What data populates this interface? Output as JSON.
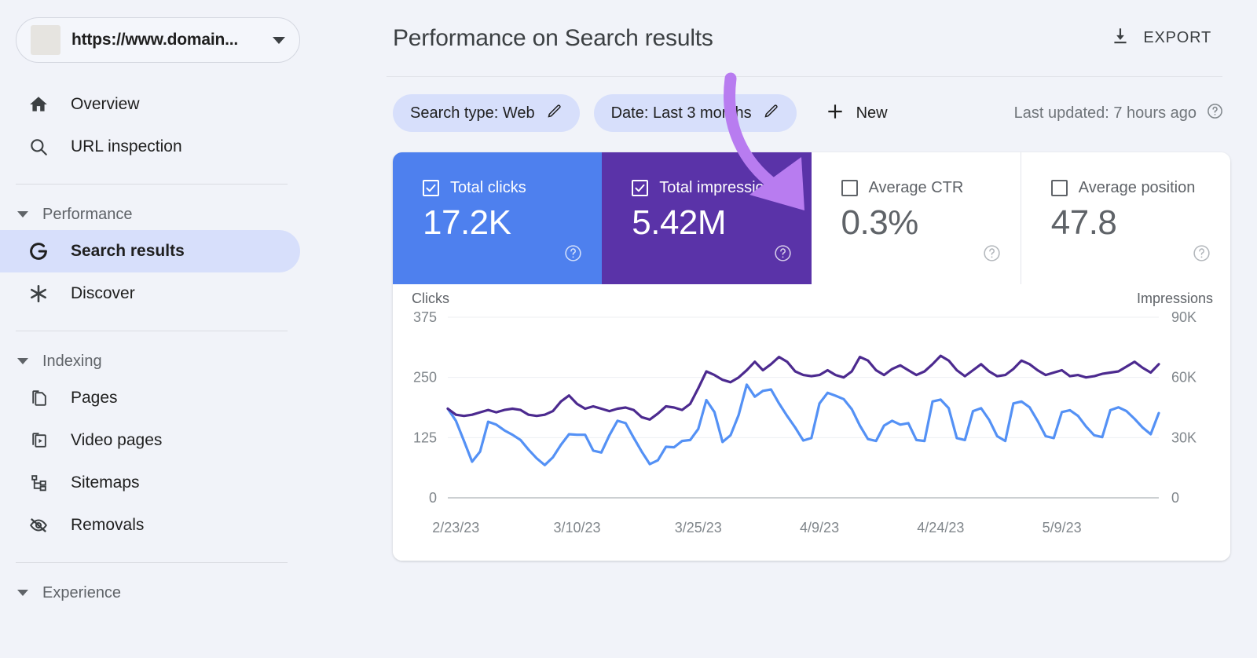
{
  "sidebar": {
    "property": {
      "url": "https://www.domain...",
      "caret_icon": "chevron-down-icon"
    },
    "items": [
      {
        "id": "overview",
        "label": "Overview",
        "icon": "home-icon",
        "selected": false
      },
      {
        "id": "url-inspection",
        "label": "URL inspection",
        "icon": "search-icon",
        "selected": false
      }
    ],
    "groups": [
      {
        "id": "performance",
        "label": "Performance",
        "items": [
          {
            "id": "search-results",
            "label": "Search results",
            "icon": "google-g-icon",
            "selected": true
          },
          {
            "id": "discover",
            "label": "Discover",
            "icon": "asterisk-icon",
            "selected": false
          }
        ]
      },
      {
        "id": "indexing",
        "label": "Indexing",
        "items": [
          {
            "id": "pages",
            "label": "Pages",
            "icon": "pages-icon",
            "selected": false
          },
          {
            "id": "video-pages",
            "label": "Video pages",
            "icon": "video-pages-icon",
            "selected": false
          },
          {
            "id": "sitemaps",
            "label": "Sitemaps",
            "icon": "sitemap-icon",
            "selected": false
          },
          {
            "id": "removals",
            "label": "Removals",
            "icon": "eye-off-icon",
            "selected": false
          }
        ]
      },
      {
        "id": "experience",
        "label": "Experience",
        "items": []
      }
    ]
  },
  "header": {
    "title": "Performance on Search results",
    "export_label": "EXPORT",
    "export_icon": "download-icon"
  },
  "filters": {
    "chips": [
      {
        "id": "search-type",
        "label": "Search type: Web",
        "edit_icon": "pencil-icon"
      },
      {
        "id": "date",
        "label": "Date: Last 3 months",
        "edit_icon": "pencil-icon"
      }
    ],
    "new_label": "New",
    "new_icon": "plus-icon",
    "last_updated": "Last updated: 7 hours ago",
    "help_icon": "help-circle-icon"
  },
  "metrics": [
    {
      "id": "total-clicks",
      "label": "Total clicks",
      "value": "17.2K",
      "checked": true,
      "color": "#4E80EE",
      "text_color": "#ffffff"
    },
    {
      "id": "total-impressions",
      "label": "Total impressions",
      "value": "5.42M",
      "checked": true,
      "color": "#5A33A8",
      "text_color": "#ffffff"
    },
    {
      "id": "average-ctr",
      "label": "Average CTR",
      "value": "0.3%",
      "checked": false,
      "color": "#ffffff",
      "text_color": "#5F6368"
    },
    {
      "id": "average-position",
      "label": "Average position",
      "value": "47.8",
      "checked": false,
      "color": "#ffffff",
      "text_color": "#5F6368"
    }
  ],
  "annotation": {
    "type": "curved-arrow",
    "color": "#B87CF0",
    "points_to": "total-clicks"
  },
  "chart_data": {
    "type": "line",
    "title": "",
    "xlabel": "",
    "ylabel": "Clicks",
    "y2label": "Impressions",
    "grid": true,
    "legend": "none",
    "ylim": [
      0,
      375
    ],
    "y2lim": [
      0,
      90000
    ],
    "yticks": [
      "0",
      "125",
      "250",
      "375"
    ],
    "ytick_values": [
      0,
      125,
      250,
      375
    ],
    "y2ticks": [
      "0",
      "30K",
      "60K",
      "90K"
    ],
    "y2tick_values": [
      0,
      30000,
      60000,
      90000
    ],
    "xticks": [
      "2/23/23",
      "3/10/23",
      "3/25/23",
      "4/9/23",
      "4/24/23",
      "5/9/23"
    ],
    "xtick_indices": [
      1,
      16,
      31,
      46,
      61,
      76
    ],
    "x_start": "2/22/23",
    "x_end": "5/21/23",
    "n_points": 89,
    "series": [
      {
        "name": "Clicks",
        "axis": "left",
        "color": "#5491F5",
        "values": [
          185,
          160,
          118,
          75,
          96,
          158,
          152,
          140,
          131,
          120,
          100,
          82,
          68,
          84,
          110,
          132,
          131,
          131,
          98,
          94,
          130,
          160,
          155,
          125,
          96,
          70,
          78,
          106,
          105,
          118,
          120,
          143,
          203,
          178,
          116,
          130,
          172,
          235,
          210,
          222,
          225,
          196,
          170,
          146,
          119,
          124,
          196,
          218,
          212,
          205,
          184,
          150,
          122,
          118,
          150,
          160,
          152,
          155,
          120,
          118,
          200,
          204,
          186,
          124,
          120,
          180,
          186,
          162,
          128,
          118,
          196,
          200,
          188,
          160,
          128,
          124,
          178,
          182,
          170,
          148,
          130,
          126,
          182,
          188,
          180,
          164,
          146,
          132,
          176
        ]
      },
      {
        "name": "Impressions",
        "axis": "right",
        "color": "#4C2A8F",
        "values": [
          44400,
          41400,
          40800,
          41400,
          42600,
          43800,
          42600,
          43800,
          44400,
          43800,
          41400,
          40800,
          41400,
          43200,
          48000,
          51000,
          46800,
          44400,
          45600,
          44400,
          43200,
          44400,
          45000,
          43800,
          40200,
          39000,
          42000,
          45600,
          45000,
          43800,
          46800,
          54600,
          63000,
          61200,
          58800,
          57600,
          60000,
          63600,
          67800,
          63600,
          66600,
          70200,
          67800,
          63000,
          61200,
          60600,
          61200,
          63600,
          61200,
          60000,
          63000,
          70200,
          68400,
          63600,
          61200,
          64200,
          66000,
          63600,
          61200,
          63000,
          66600,
          70800,
          68400,
          63600,
          60600,
          63600,
          66600,
          63000,
          60600,
          61200,
          64200,
          68400,
          66600,
          63600,
          61200,
          62400,
          63600,
          60600,
          61200,
          60000,
          60600,
          61800,
          62400,
          63000,
          65400,
          67800,
          64800,
          62400,
          66600
        ]
      }
    ]
  }
}
